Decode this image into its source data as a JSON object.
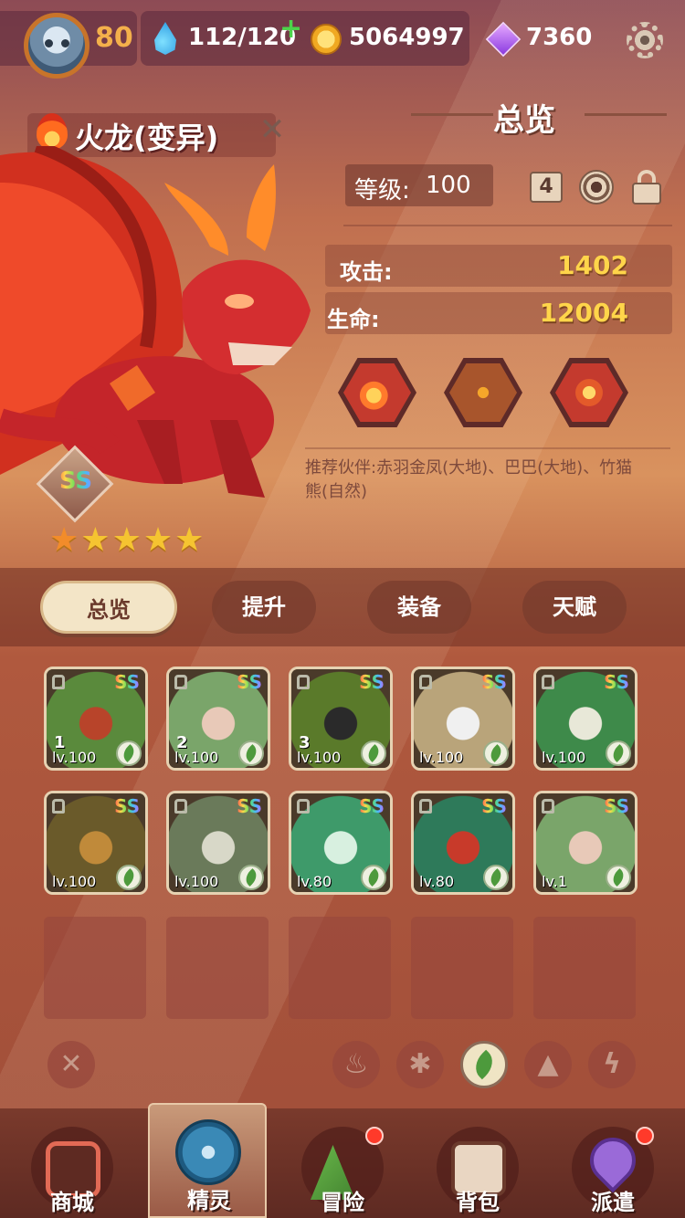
{
  "topbar": {
    "player_level": "80",
    "energy": "112/120",
    "coins": "5064997",
    "gems": "7360"
  },
  "monster": {
    "name": "火龙(变异)",
    "rank": "SS",
    "stars": 5
  },
  "overview": {
    "title": "总览",
    "level_label": "等级:",
    "level_value": "100",
    "slot_number": "4",
    "stats": [
      {
        "label": "攻击:",
        "value": "1402"
      },
      {
        "label": "生命:",
        "value": "12004"
      }
    ],
    "skills": [
      "fireball-skill-icon",
      "cross-slash-skill-icon",
      "twin-flame-skill-icon"
    ],
    "partners_text": "推荐伙伴:赤羽金凤(大地)、巴巴(大地)、竹猫熊(自然)"
  },
  "tabs": [
    "总览",
    "提升",
    "装备",
    "天赋"
  ],
  "active_tab": 0,
  "spirits": [
    {
      "rank": "SS",
      "num": "1",
      "level": "lv.100",
      "colors": [
        "#5a8a3c",
        "#b8442a"
      ]
    },
    {
      "rank": "SS",
      "num": "2",
      "level": "lv.100",
      "colors": [
        "#7aa56a",
        "#e8c9b8"
      ]
    },
    {
      "rank": "SS",
      "num": "3",
      "level": "lv.100",
      "colors": [
        "#5a7a2a",
        "#2a2a2a"
      ]
    },
    {
      "rank": "SS",
      "num": "",
      "level": "lv.100",
      "colors": [
        "#b9a47a",
        "#f0f0f0"
      ]
    },
    {
      "rank": "SS",
      "num": "",
      "level": "lv.100",
      "colors": [
        "#3e8a4a",
        "#e8e8d8"
      ]
    },
    {
      "rank": "SS",
      "num": "",
      "level": "lv.100",
      "colors": [
        "#6a5a2a",
        "#c08a3a"
      ]
    },
    {
      "rank": "SS",
      "num": "",
      "level": "lv.100",
      "colors": [
        "#6a7a5a",
        "#d8d8c8"
      ]
    },
    {
      "rank": "SS",
      "num": "",
      "level": "lv.80",
      "colors": [
        "#3e9a6a",
        "#d8f0e0"
      ]
    },
    {
      "rank": "SS",
      "num": "",
      "level": "lv.80",
      "colors": [
        "#2e7a5a",
        "#c83a2a"
      ]
    },
    {
      "rank": "SS",
      "num": "",
      "level": "lv.1",
      "colors": [
        "#7aa56a",
        "#e8c9b8"
      ]
    }
  ],
  "filters": [
    "clear-filter-icon",
    "fire-element-icon",
    "wind-element-icon",
    "nature-element-icon",
    "earth-element-icon",
    "thunder-element-icon"
  ],
  "active_filter": 3,
  "nav": [
    {
      "label": "商城",
      "icon": "shop-icon",
      "notify": false
    },
    {
      "label": "精灵",
      "icon": "spirit-icon",
      "notify": false
    },
    {
      "label": "冒险",
      "icon": "adventure-icon",
      "notify": true
    },
    {
      "label": "背包",
      "icon": "backpack-icon",
      "notify": false
    },
    {
      "label": "派遣",
      "icon": "dispatch-icon",
      "notify": true
    }
  ],
  "active_nav": 1,
  "colors": {
    "gold_value": "#ffd54a",
    "accent_orange": "#f4b04b",
    "tab_active": "#f3e5c7"
  }
}
